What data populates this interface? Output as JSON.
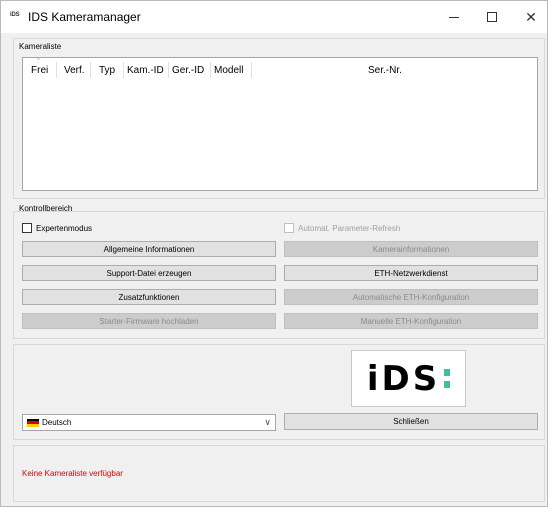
{
  "window": {
    "title": "IDS Kameramanager",
    "logo_text": "iDS"
  },
  "camera_list": {
    "group_label": "Kameraliste",
    "sort_indicator": "^",
    "columns": [
      "Frei",
      "Verf.",
      "Typ",
      "Kam.-ID",
      "Ger.-ID",
      "Modell",
      "Ser.-Nr."
    ],
    "rows": []
  },
  "control_area": {
    "group_label": "Kontrollbereich",
    "expert_mode": {
      "label": "Expertenmodus",
      "checked": false
    },
    "auto_refresh": {
      "label": "Automat. Parameter-Refresh",
      "checked": false,
      "enabled": false
    },
    "buttons": {
      "general_info": "Allgemeine Informationen",
      "camera_info": "Kamerainformationen",
      "support_file": "Support-Datei erzeugen",
      "eth_network_service": "ETH-Netzwerkdienst",
      "additional_functions": "Zusatzfunktionen",
      "auto_eth_config": "Automatische ETH-Konfiguration",
      "starter_firmware": "Starter-Firmware hochladen",
      "manual_eth_config": "Manuelle ETH-Konfiguration"
    }
  },
  "bottom": {
    "logo": {
      "letters": "iDS",
      "accent_color": "#3fbfa0"
    },
    "language": {
      "selected": "Deutsch",
      "flag_colors": [
        "#000000",
        "#dd0000",
        "#ffce00"
      ]
    },
    "close_button": "Schließen"
  },
  "status": {
    "message": "Keine Kameraliste verfügbar",
    "color": "#e00000"
  }
}
